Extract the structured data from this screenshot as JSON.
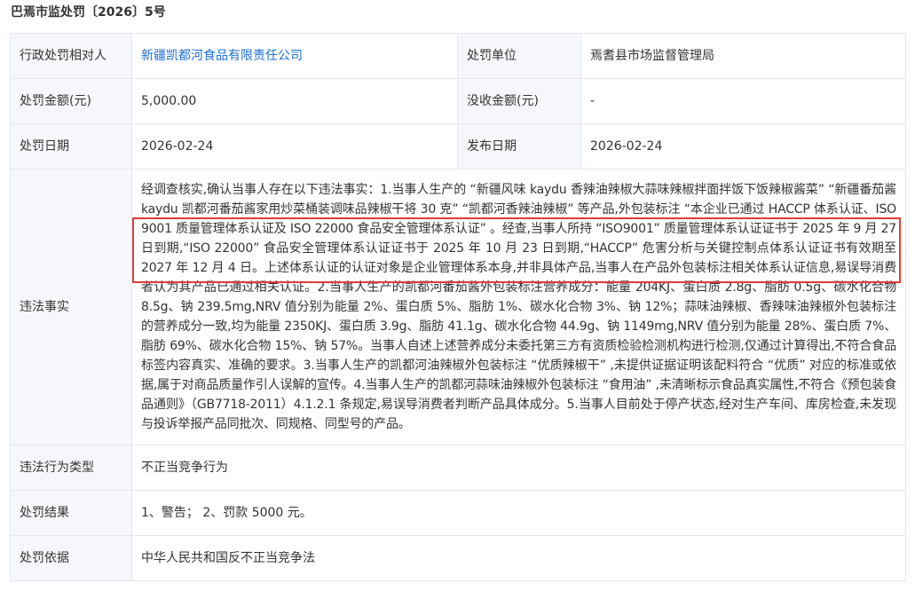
{
  "document": {
    "title": "巴焉市监处罚〔2026〕5号"
  },
  "rows": {
    "party_label": "行政处罚相对人",
    "party_value": "新疆凯都河食品有限责任公司",
    "authority_label": "处罚单位",
    "authority_value": "焉耆县市场监督管理局",
    "fine_label": "处罚金额(元)",
    "fine_value": "5,000.00",
    "confiscation_label": "没收金额(元)",
    "confiscation_value": "-",
    "date_label": "处罚日期",
    "date_value": "2026-02-24",
    "publish_label": "发布日期",
    "publish_value": "2026-02-24",
    "facts_label": "违法事实",
    "facts_text": "经调查核实,确认当事人存在以下违法事实：1.当事人生产的 “新疆风味 kaydu 香辣油辣椒大蒜味辣椒拌面拌饭下饭辣椒酱菜” “新疆番茄酱 kaydu 凯都河番茄酱家用炒菜桶装调味品辣椒干将 30 克” “凯都河香辣油辣椒” 等产品,外包装标注 “本企业已通过 HACCP 体系认证、ISO 9001 质量管理体系认证及 ISO 22000 食品安全管理体系认证” 。经查,当事人所持 “ISO9001” 质量管理体系认证证书于 2025 年 9 月 27 日到期,“ISO 22000” 食品安全管理体系认证证书于 2025 年 10 月 23 日到期,“HACCP” 危害分析与关键控制点体系认证证书有效期至 2027 年 12 月 4 日。上述体系认证的认证对象是企业管理体系本身,并非具体产品,当事人在产品外包装标注相关体系认证信息,易误导消费者认为其产品已通过相关认证。2.当事人生产的凯都河番茄酱外包装标注营养成分：能量 204KJ、蛋白质 2.8g、脂肪 0.5g、碳水化合物 8.5g、钠 239.5mg,NRV 值分别为能量 2%、蛋白质 5%、脂肪 1%、碳水化合物 3%、钠 12%；蒜味油辣椒、香辣味油辣椒外包装标注的营养成分一致,均为能量 2350KJ、蛋白质 3.9g、脂肪 41.1g、碳水化合物 44.9g、钠 1149mg,NRV 值分别为能量 28%、蛋白质 7%、脂肪 69%、碳水化合物 15%、钠 57%。当事人自述上述营养成分未委托第三方有资质检验检测机构进行检测,仅通过计算得出,不符合食品标签内容真实、准确的要求。3.当事人生产的凯都河油辣椒外包装标注 “优质辣椒干” ,未提供证据证明该配料符合 “优质” 对应的标准或依据,属于对商品质量作引人误解的宣传。4.当事人生产的凯都河蒜味油辣椒外包装标注 “食用油” ,未清晰标示食品真实属性,不符合《预包装食品通则》（GB7718-2011）4.1.2.1 条规定,易误导消费者判断产品具体成分。5.当事人目前处于停产状态,经对生产车间、库房检查,未发现与投诉举报产品同批次、同规格、同型号的产品。",
    "type_label": "违法行为类型",
    "type_value": "不正当竞争行为",
    "result_label": "处罚结果",
    "result_value": "1、警告； 2、罚款 5000 元。",
    "basis_label": "处罚依据",
    "basis_value": "中华人民共和国反不正当竞争法"
  },
  "colors": {
    "link": "#1f6fd3",
    "label_bg": "#f5f7fa",
    "border": "#e4e7ed",
    "highlight": "#e23b3b"
  }
}
